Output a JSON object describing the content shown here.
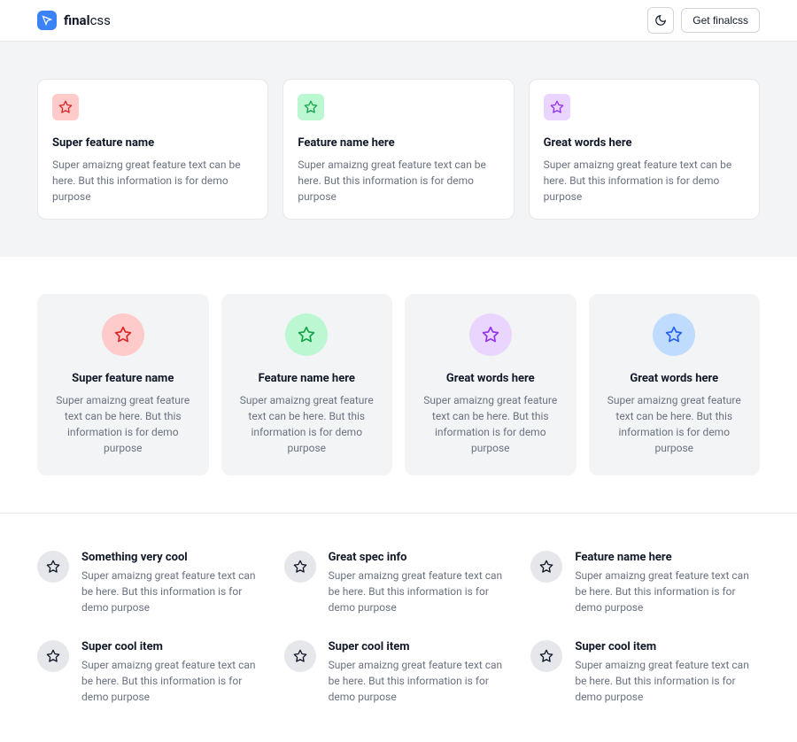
{
  "header": {
    "brand_bold": "final",
    "brand_light": "css",
    "cta": "Get finalcss"
  },
  "section1": [
    {
      "title": "Super feature name",
      "desc": "Super amaizng great feature text can be here. But this information is for demo purpose",
      "color": "red"
    },
    {
      "title": "Feature name here",
      "desc": "Super amaizng great feature text can be here. But this information is for demo purpose",
      "color": "green"
    },
    {
      "title": "Great words here",
      "desc": "Super amaizng great feature text can be here. But this information is for demo purpose",
      "color": "purple"
    }
  ],
  "section2": [
    {
      "title": "Super feature name",
      "desc": "Super amaizng great feature text can be here. But this information is for demo purpose",
      "color": "red"
    },
    {
      "title": "Feature name here",
      "desc": "Super amaizng great feature text can be here. But this information is for demo purpose",
      "color": "green"
    },
    {
      "title": "Great words here",
      "desc": "Super amaizng great feature text can be here. But this information is for demo purpose",
      "color": "purple"
    },
    {
      "title": "Great words here",
      "desc": "Super amaizng great feature text can be here. But this information is for demo purpose",
      "color": "blue"
    }
  ],
  "section3": [
    {
      "title": "Something very cool",
      "desc": "Super amaizng great feature text can be here. But this information is for demo purpose"
    },
    {
      "title": "Great spec info",
      "desc": "Super amaizng great feature text can be here. But this information is for demo purpose"
    },
    {
      "title": "Feature name here",
      "desc": "Super amaizng great feature text can be here. But this information is for demo purpose"
    },
    {
      "title": "Super cool item",
      "desc": "Super amaizng great feature text can be here. But this information is for demo purpose"
    },
    {
      "title": "Super cool item",
      "desc": "Super amaizng great feature text can be here. But this information is for demo purpose"
    },
    {
      "title": "Super cool item",
      "desc": "Super amaizng great feature text can be here. But this information is for demo purpose"
    }
  ],
  "icon_colors": {
    "red": "#dc2626",
    "green": "#16a34a",
    "purple": "#9333ea",
    "blue": "#2563eb",
    "black": "#111827"
  }
}
